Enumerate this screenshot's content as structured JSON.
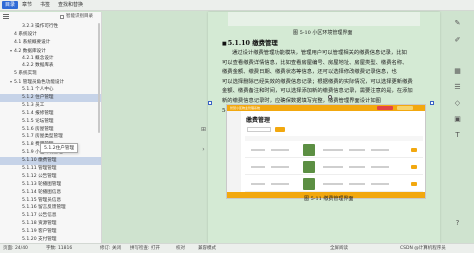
{
  "topbar": {
    "tabs": [
      "目录",
      "章节",
      "书签",
      "查找和替换"
    ]
  },
  "nav": {
    "smart_label": "智能识别目录",
    "items": [
      {
        "label": "3.2.3 操作可行性",
        "indent": 22,
        "caret": false
      },
      {
        "label": "4 系统设计",
        "indent": 14,
        "caret": false
      },
      {
        "label": "4.1 系统概要设计",
        "indent": 14,
        "caret": false
      },
      {
        "label": "4.2 数据库设计",
        "indent": 10,
        "caret": true
      },
      {
        "label": "4.2.1 概念设计",
        "indent": 22,
        "caret": false
      },
      {
        "label": "4.2.2 数据库表",
        "indent": 22,
        "caret": false
      },
      {
        "label": "5 系统实现",
        "indent": 14,
        "caret": false
      },
      {
        "label": "5.1 管理员角色功能设计",
        "indent": 10,
        "caret": true
      },
      {
        "label": "5.1.1 个人中心",
        "indent": 22,
        "caret": false
      },
      {
        "label": "5.1.2 住户管理",
        "indent": 22,
        "caret": false,
        "selected": true
      },
      {
        "label": "5.1.3 员工",
        "indent": 22,
        "caret": false
      },
      {
        "label": "5.1.4 报修管理",
        "indent": 22,
        "caret": false
      },
      {
        "label": "5.1.5 论坛管理",
        "indent": 22,
        "caret": false
      },
      {
        "label": "5.1.6 房屋管理",
        "indent": 22,
        "caret": false
      },
      {
        "label": "5.1.7 房屋类型管理",
        "indent": 22,
        "caret": false
      },
      {
        "label": "5.1.8 费用管理",
        "indent": 22,
        "caret": false
      },
      {
        "label": "5.1.9 小区环境管理",
        "indent": 22,
        "caret": false
      },
      {
        "label": "5.1.10 缴费管理",
        "indent": 22,
        "caret": false,
        "selected": true
      },
      {
        "label": "5.1.11 管理管理",
        "indent": 22,
        "caret": false
      },
      {
        "label": "5.1.12 公告管理",
        "indent": 22,
        "caret": false
      },
      {
        "label": "5.1.13 轮播图管理",
        "indent": 22,
        "caret": false
      },
      {
        "label": "5.1.14 轮播图信息",
        "indent": 22,
        "caret": false
      },
      {
        "label": "5.1.15 管理员信息",
        "indent": 22,
        "caret": false
      },
      {
        "label": "5.1.16 留言反馈管理",
        "indent": 22,
        "caret": false
      },
      {
        "label": "5.1.17 公告信息",
        "indent": 22,
        "caret": false
      },
      {
        "label": "5.1.18 资源管理",
        "indent": 22,
        "caret": false
      },
      {
        "label": "5.1.19 客户管理",
        "indent": 22,
        "caret": false
      },
      {
        "label": "5.1.20 支付管理",
        "indent": 22,
        "caret": false
      },
      {
        "label": "5.1.21 留言管理",
        "indent": 22,
        "caret": false
      }
    ],
    "tooltip": "5.1.2住户管理"
  },
  "doc": {
    "caption_top": "图 5-10 小区环境管理界面",
    "heading": "5.1.10 缴费管理",
    "paragraph_lines": [
      "通过设计缴费管理功能模块，管理用户可以管理相关的缴费信息记录，比如",
      "可以查看缴费详情信息，比如查看房屋编号、房屋地址、房屋类型、缴费名称、",
      "缴费金额、缴费日期、缴费状态等信息，还可以选择修改缴费记录信息，也",
      "可以选择删除已经失效的缴费信息记录；根据缴费的实际情况，可以选择更新缴费",
      "金额、缴费备注和时间，可以选择添加新的缴费信息记录，需要注意的是，在添加",
      "新的缴费信息记录时，应确保数据填写完整，缴费管理界面设计如图",
      "5-11 所示。"
    ],
    "caption_bottom": "图 5-11 缴费管理界面",
    "shot": {
      "header_text": "智慧小区物业管理系统",
      "title": "缴费管理"
    }
  },
  "right_tools": [
    "comment-icon",
    "edit-icon",
    "grid-icon",
    "list-icon",
    "shape-icon",
    "image-icon",
    "text-icon",
    "help-icon"
  ],
  "status": {
    "page": "页面: 24/40",
    "words": "字数: 11816",
    "spell": "拼写检查: 打开",
    "revise": "修订: 关闭",
    "review": "校对",
    "compat": "兼容模式",
    "mode": "全屏阅读",
    "watermark": "CSDN @计算机程序员"
  }
}
